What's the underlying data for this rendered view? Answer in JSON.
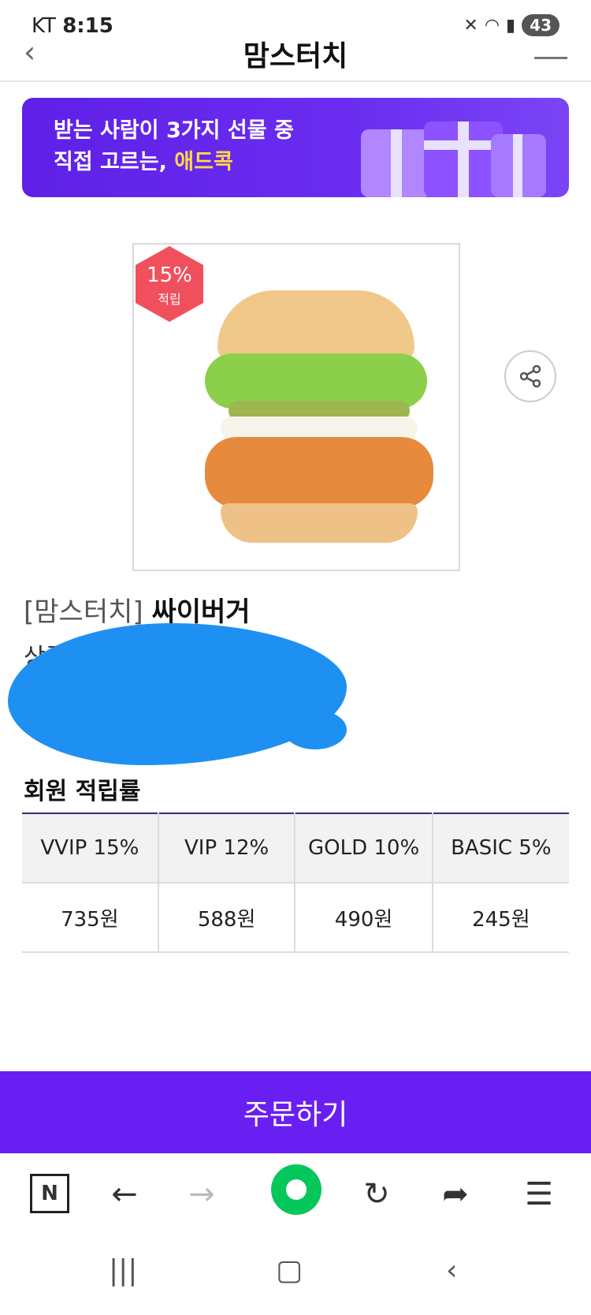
{
  "status_bar": {
    "carrier": "KT",
    "time": "8:15",
    "battery": "43"
  },
  "app_bar": {
    "title": "맘스터치"
  },
  "banner": {
    "line1": "받는 사람이 3가지 선물 중",
    "line2_prefix": "직접 고르는,",
    "line2_highlight": "애드콕"
  },
  "product": {
    "badge_percent": "15%",
    "badge_label": "적립",
    "brand": "[맘스터치]",
    "name": "싸이버거",
    "price_label": "상품가격"
  },
  "rewards": {
    "title": "회원 적립률",
    "headers": [
      "VVIP 15%",
      "VIP 12%",
      "GOLD 10%",
      "BASIC 5%"
    ],
    "values": [
      "735원",
      "588원",
      "490원",
      "245원"
    ]
  },
  "order_button": {
    "label": "주문하기"
  },
  "browser_toolbar": {
    "n_label": "N"
  },
  "colors": {
    "accent": "#6a1ff2",
    "badge": "#f0505c",
    "naver_green": "#03c75a"
  }
}
